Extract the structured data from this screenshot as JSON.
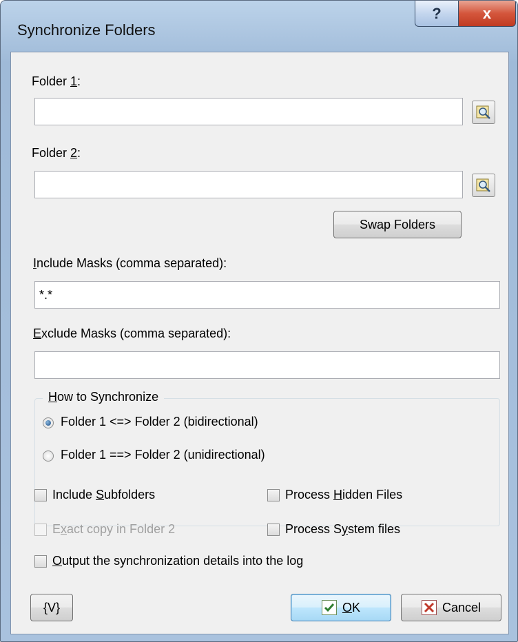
{
  "window": {
    "title": "Synchronize Folders",
    "help_label": "?",
    "close_label": "x"
  },
  "folder1": {
    "label_pre": "Folder ",
    "label_u": "1",
    "label_post": ":",
    "value": ""
  },
  "folder2": {
    "label_pre": "Folder ",
    "label_u": "2",
    "label_post": ":",
    "value": ""
  },
  "swap_label": "Swap Folders",
  "include": {
    "label_u": "I",
    "label_rest": "nclude Masks (comma separated):",
    "value": "*.*"
  },
  "exclude": {
    "label_u": "E",
    "label_rest": "xclude Masks (comma separated):",
    "value": ""
  },
  "sync": {
    "title_u": "H",
    "title_rest": "ow to Synchronize",
    "options": [
      {
        "label": "Folder 1 <=> Folder 2 (bidirectional)",
        "selected": true
      },
      {
        "label": "Folder 1 ==> Folder 2 (unidirectional)",
        "selected": false
      }
    ]
  },
  "options": {
    "subfolders": {
      "pre": "Include ",
      "u": "S",
      "post": "ubfolders"
    },
    "exact": {
      "pre": "E",
      "u": "x",
      "post": "act copy in Folder 2"
    },
    "hidden": {
      "pre": "Process ",
      "u": "H",
      "post": "idden Files"
    },
    "system": {
      "pre": "Process S",
      "u": "y",
      "post": "stem files"
    },
    "log": {
      "pre": "",
      "u": "O",
      "post": "utput the synchronization details into the log"
    }
  },
  "buttons": {
    "vars": "{V}",
    "ok_u": "O",
    "ok_rest": "K",
    "cancel": "Cancel"
  },
  "colors": {
    "title_bar": "#a9c2de",
    "client": "#f0f0f0",
    "default_button": "#3c7fb1"
  }
}
